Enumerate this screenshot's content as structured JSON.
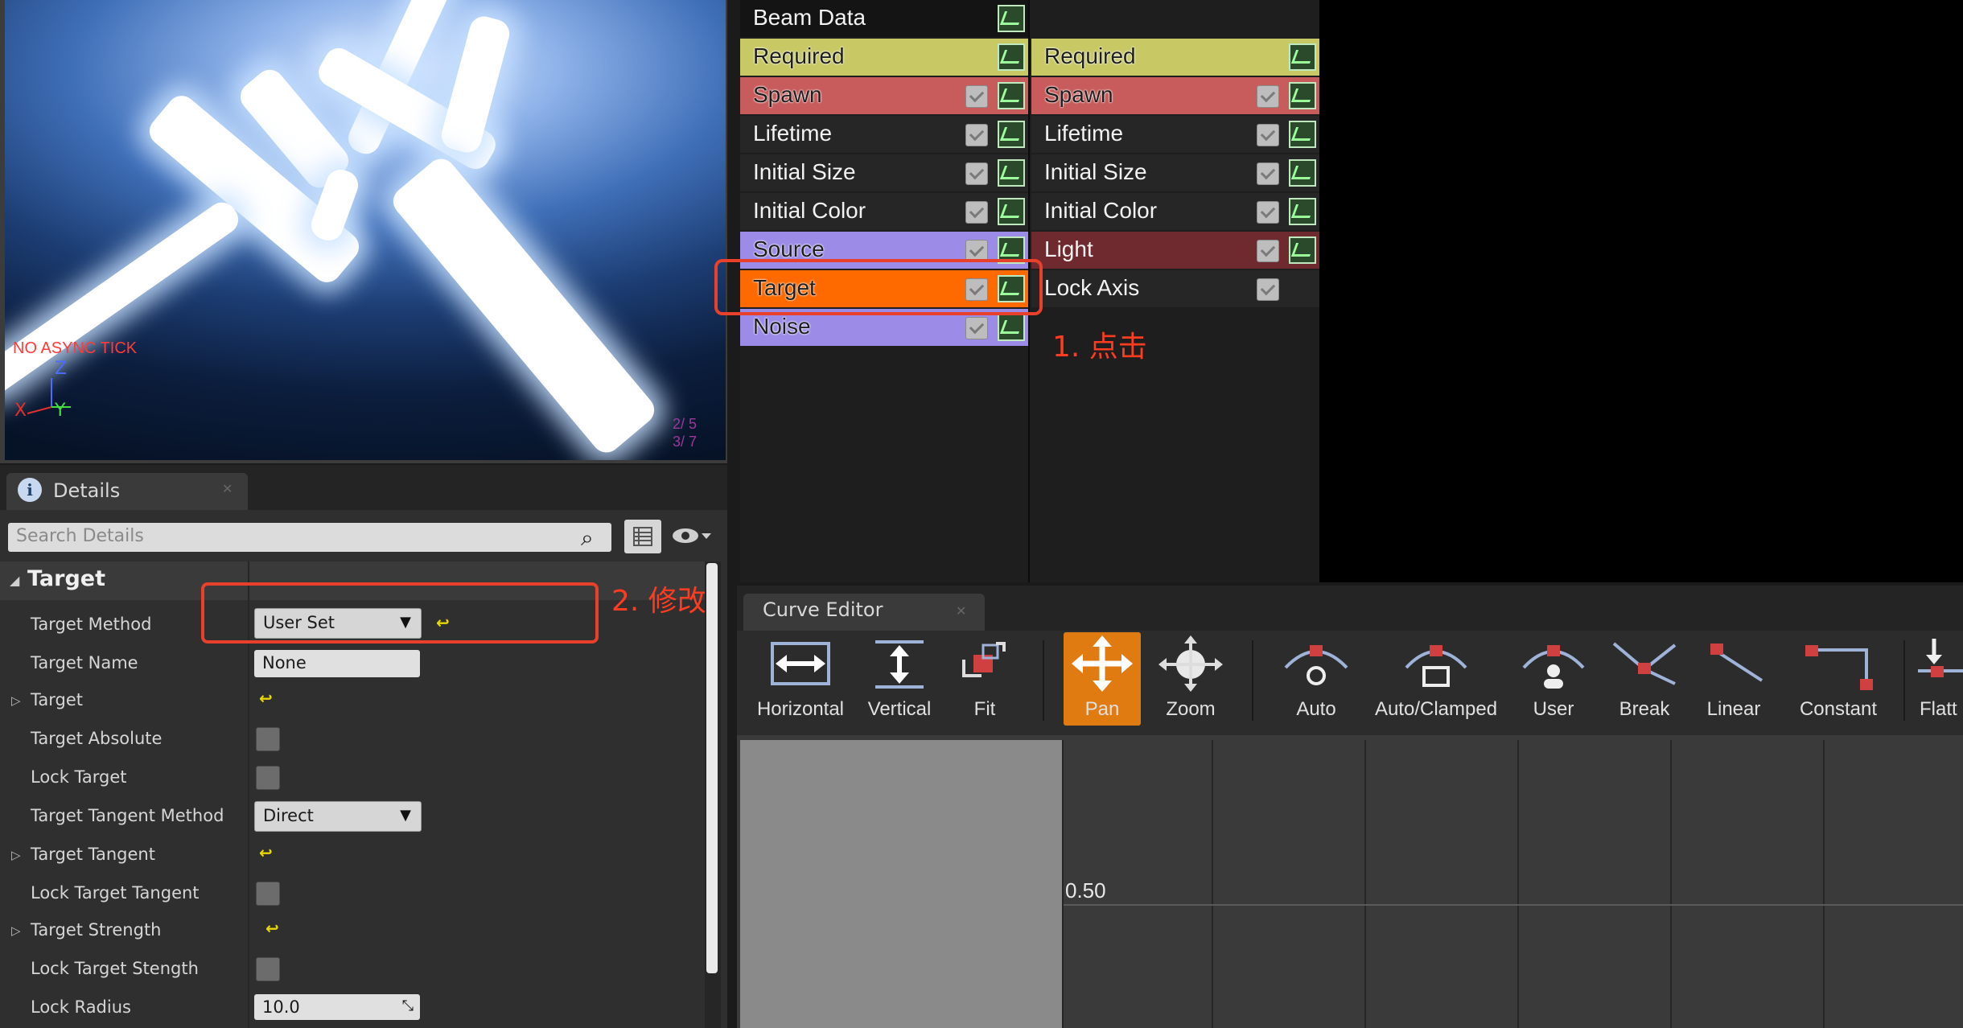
{
  "viewport": {
    "status_text": "NO ASYNC TICK",
    "axis_x": "X",
    "axis_y": "Y",
    "axis_z": "Z",
    "stat_row1": "2/  5",
    "stat_row2": "3/  7"
  },
  "details": {
    "tab_title": "Details",
    "search_placeholder": "Search Details",
    "category": "Target",
    "properties": [
      {
        "label": "Target Method",
        "type": "dropdown",
        "value": "User Set",
        "reset": true
      },
      {
        "label": "Target Name",
        "type": "text",
        "value": "None"
      },
      {
        "label": "Target",
        "type": "expand",
        "reset": true
      },
      {
        "label": "Target Absolute",
        "type": "checkbox",
        "checked": false
      },
      {
        "label": "Lock Target",
        "type": "checkbox",
        "checked": false
      },
      {
        "label": "Target Tangent Method",
        "type": "dropdown",
        "value": "Direct"
      },
      {
        "label": "Target Tangent",
        "type": "expand",
        "reset": true
      },
      {
        "label": "Lock Target Tangent",
        "type": "checkbox",
        "checked": false
      },
      {
        "label": "Target Strength",
        "type": "expand",
        "reset": true
      },
      {
        "label": "Lock Target Stength",
        "type": "checkbox",
        "checked": false
      },
      {
        "label": "Lock Radius",
        "type": "number",
        "value": "10.0"
      }
    ]
  },
  "emitter_left": {
    "header": "Beam Data",
    "modules": [
      {
        "label": "Required",
        "color": "#c8c864"
      },
      {
        "label": "Spawn",
        "color": "#c85c5c"
      },
      {
        "label": "Lifetime",
        "color": "#262626"
      },
      {
        "label": "Initial Size",
        "color": "#262626"
      },
      {
        "label": "Initial Color",
        "color": "#262626"
      },
      {
        "label": "Source",
        "color": "#9c8ce8"
      },
      {
        "label": "Target",
        "color": "#ff6a00"
      },
      {
        "label": "Noise",
        "color": "#9c8ce8"
      }
    ]
  },
  "emitter_right": {
    "modules": [
      {
        "label": "Required",
        "color": "#c8c864"
      },
      {
        "label": "Spawn",
        "color": "#c85c5c"
      },
      {
        "label": "Lifetime",
        "color": "#262626"
      },
      {
        "label": "Initial Size",
        "color": "#262626"
      },
      {
        "label": "Initial Color",
        "color": "#262626"
      },
      {
        "label": "Light",
        "color": "#6e2a2e"
      },
      {
        "label": "Lock Axis",
        "color": "#262626"
      }
    ]
  },
  "annotations": {
    "step1": "1. 点击",
    "step2": "2. 修改"
  },
  "curve_editor": {
    "tab_title": "Curve Editor",
    "tools": [
      {
        "label": "Horizontal",
        "icon": "horizontal-fit-icon"
      },
      {
        "label": "Vertical",
        "icon": "vertical-fit-icon"
      },
      {
        "label": "Fit",
        "icon": "fit-icon"
      },
      {
        "label": "Pan",
        "icon": "pan-icon",
        "active": true
      },
      {
        "label": "Zoom",
        "icon": "zoom-icon"
      },
      {
        "label": "Auto",
        "icon": "auto-tangent-icon"
      },
      {
        "label": "Auto/Clamped",
        "icon": "auto-clamped-tangent-icon"
      },
      {
        "label": "User",
        "icon": "user-tangent-icon"
      },
      {
        "label": "Break",
        "icon": "break-tangent-icon"
      },
      {
        "label": "Linear",
        "icon": "linear-interp-icon"
      },
      {
        "label": "Constant",
        "icon": "constant-interp-icon"
      },
      {
        "label": "Flatt",
        "icon": "flatten-icon"
      }
    ],
    "graph_label": "0.50"
  },
  "colors": {
    "accent_orange": "#e07b12",
    "annotation_red": "#e8402a",
    "reset_yellow": "#e6d800"
  }
}
